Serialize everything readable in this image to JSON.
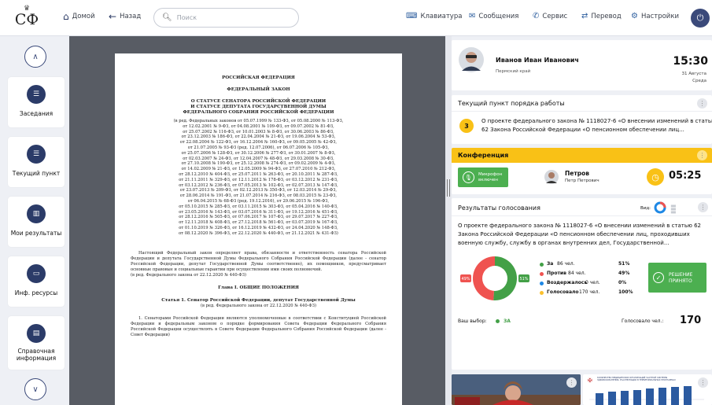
{
  "topbar": {
    "logo_text": "СФ",
    "home_label": "Домой",
    "back_label": "Назад",
    "search_placeholder": "Поиск",
    "tools": [
      {
        "label": "Клавиатура",
        "icon": "keyboard-icon"
      },
      {
        "label": "Сообщения",
        "icon": "messages-icon"
      },
      {
        "label": "Сервис",
        "icon": "service-icon"
      },
      {
        "label": "Перевод",
        "icon": "translate-icon"
      },
      {
        "label": "Настройки",
        "icon": "settings-icon"
      }
    ]
  },
  "sidebar": {
    "items": [
      {
        "label": "Заседания",
        "icon": "list-icon"
      },
      {
        "label": "Текущий пункт",
        "icon": "list-icon"
      },
      {
        "label": "Мои результаты",
        "icon": "bar-chart-icon"
      },
      {
        "label": "Инф. ресурсы",
        "icon": "monitor-icon"
      },
      {
        "label": "Справочная информация",
        "icon": "document-icon"
      }
    ]
  },
  "document": {
    "l1": "РОССИЙСКАЯ ФЕДЕРАЦИЯ",
    "l2": "ФЕДЕРАЛЬНЫЙ ЗАКОН",
    "t1": "О СТАТУСЕ СЕНАТОРА РОССИЙСКОЙ ФЕДЕРАЦИИ",
    "t2": "И СТАТУСЕ ДЕПУТАТА ГОСУДАРСТВЕННОЙ ДУМЫ",
    "t3": "ФЕДЕРАЛЬНОГО СОБРАНИЯ РОССИЙСКОЙ ФЕДЕРАЦИИ",
    "amend_lines": [
      "(в ред. Федеральных законов от 05.07.1999 № 133-ФЗ, от 05.08.2000 № 113-ФЗ,",
      "от 12.02.2001 № 9-ФЗ, от 04.08.2001 № 109-ФЗ, от 09.07.2002 № 81-ФЗ,",
      "от 25.07.2002 № 116-ФЗ, от 10.01.2003 № 8-ФЗ, от 30.06.2003 № 86-ФЗ,",
      "от 23.12.2003 № 186-ФЗ, от 22.04.2004 № 21-ФЗ, от 19.06.2004 № 53-ФЗ,",
      "от 22.08.2004 № 122-ФЗ, от 16.12.2004 № 160-ФЗ, от 09.05.2005 № 42-ФЗ,",
      "от 21.07.2005 № 93-ФЗ (ред. 12.07.2006), от 06.07.2006 № 105-ФЗ,",
      "от 25.07.2006 № 128-ФЗ, от 30.12.2006 № 277-ФЗ, от 30.01.2007 № 8-ФЗ,",
      "от 02.03.2007 № 24-ФЗ, от 12.04.2007 № 48-ФЗ, от 29.03.2008 № 30-ФЗ,",
      "от 27.10.2008 № 190-ФЗ, от 25.12.2008 № 274-ФЗ, от 09.02.2009 № 4-ФЗ,",
      "от 14.02.2009 № 21-ФЗ, от 12.05.2009 № 94-ФЗ, от 27.07.2010 № 212-ФЗ,",
      "от 28.12.2010 № 404-ФЗ, от 25.07.2011 № 263-ФЗ, от 20.10.2011 № 287-ФЗ,",
      "от 21.11.2011 № 329-ФЗ, от 12.11.2012 № 178-ФЗ, от 03.12.2012 № 231-ФЗ,",
      "от 03.12.2012 № 236-ФЗ, от 07.05.2013 № 102-ФЗ, от 02.07.2013 № 147-ФЗ,",
      "от 23.07.2013 № 209-ФЗ, от 02.12.2013 № 350-ФЗ, от 12.03.2014 № 29-ФЗ,",
      "от 28.06.2014 № 191-ФЗ, от 21.07.2014 № 216-ФЗ, от 08.03.2015 № 23-ФЗ,",
      "от 06.04.2015 № 68-ФЗ (ред. 19.12.2016), от 29.06.2015 № 196-ФЗ,",
      "от 05.10.2015 № 285-ФЗ, от 03.11.2015 № 303-ФЗ, от 05.04.2016 № 140-ФЗ,",
      "от 23.05.2016 № 143-ФЗ, от 03.07.2016 № 311-ФЗ, от 19.12.2016 № 451-ФЗ,",
      "от 28.12.2016 № 505-ФЗ, от 07.06.2017 № 107-ФЗ, от 29.07.2017 № 227-ФЗ,",
      "от 12.11.2018 № 408-ФЗ, от 27.12.2018 № 561-ФЗ, от 03.07.2019 № 167-ФЗ,",
      "от 01.10.2019 № 326-ФЗ, от 16.12.2019 № 432-ФЗ, от 24.04.2020 № 148-ФЗ,",
      "от 08.12.2020 № 396-ФЗ, от 22.12.2020 № 440-ФЗ, от 21.12.2021 № 431-ФЗ)"
    ],
    "intro": "Настоящий Федеральный закон определяет права, обязанности и ответственность сенатора Российской Федерации и депутата Государственной Думы Федерального Собрания Российской Федерации (далее - сенатор Российской Федерации, депутат Государственной Думы соответственно), их помощников, предусматривает основные правовые и социальные гарантии при осуществлении ими своих полномочий.",
    "intro_ref": "(в ред. Федерального закона от 22.12.2020 № 440-ФЗ)",
    "chapter": "Глава I. ОБЩИЕ ПОЛОЖЕНИЯ",
    "article": "Статья 1. Сенатор Российской Федерации, депутат Государственной Думы",
    "article_ref": "(в ред. Федерального закона от 22.12.2020 № 440-ФЗ)",
    "clause": "1. Сенаторами Российской Федерации являются уполномоченные в соответствии с Конституцией Российской Федерации и федеральным законом о порядке формирования Совета Федерации Федерального Собрания Российской Федерации осуществлять в Совете Федерации Федерального Собрания Российской Федерации (далее - Совет Федерации)"
  },
  "profile": {
    "name": "Иванов Иван Иванович",
    "region": "Пермский край",
    "time": "15:30",
    "date": "31 Августа",
    "weekday": "Среда"
  },
  "agenda": {
    "title": "Текущий пункт порядка работы",
    "number": "3",
    "text_l1": "О проекте федерального закона № 1118027-6 «О внесении изменений в статью",
    "text_l2": "62 Закона Российской Федерации «О пенсионном обеспечении лиц..."
  },
  "conference": {
    "title": "Конференция",
    "mic_l1": "Микрофон",
    "mic_l2": "включен",
    "speaker_surname": "Петров",
    "speaker_name": "Петр Петрович",
    "timer": "05:25"
  },
  "voting": {
    "title": "Результаты голосования",
    "view_label": "Вид:",
    "text_l1": "О проекте федерального закона № 1118027-6 «О внесении изменений в статью 62",
    "text_l2": "Закона Российской Федерации «О пенсионном обеспечении лиц, проходивших",
    "text_l3": "военную службу, службу в органах внутренних дел, Государственной...",
    "pie": {
      "against_pct": 0.49,
      "for_pct": 0.51,
      "against_label": "49%",
      "for_label": "51%"
    },
    "rows": [
      {
        "label": "За",
        "count": "86 чел.",
        "pct": "51%",
        "color": "#43a047"
      },
      {
        "label": "Против",
        "count": "84 чел.",
        "pct": "49%",
        "color": "#ef5350"
      },
      {
        "label": "Воздержалось",
        "count": "0 чел.",
        "pct": "0%",
        "color": "#1e88e5"
      },
      {
        "label": "Голосовало",
        "count": "170 чел.",
        "pct": "100%",
        "color": "#fbc02d"
      }
    ],
    "decision_l1": "РЕШЕНИЕ",
    "decision_l2": "ПРИНЯТО",
    "my_choice_label": "Ваш выбор:",
    "my_choice_value": "ЗА",
    "total_label": "Голосовало чел.:",
    "total_value": "170"
  },
  "presentation": {
    "header_l1": "КОЛИЧЕСТВО МЕДИЦИНСКИХ ОРГАНИЗАЦИЙ ЧАСТНОЙ СИСТЕМЫ",
    "header_l2": "ЗДРАВООХРАНЕНИЯ, УЧАСТВУЮЩИХ В ТЕРРИТОРИАЛЬНЫХ ПРОГРАММАХ"
  },
  "colors": {
    "navy": "#2b3b68",
    "gold": "#f9c116",
    "green": "#43a047",
    "red": "#ef5350",
    "doc_bg": "#585c64"
  }
}
